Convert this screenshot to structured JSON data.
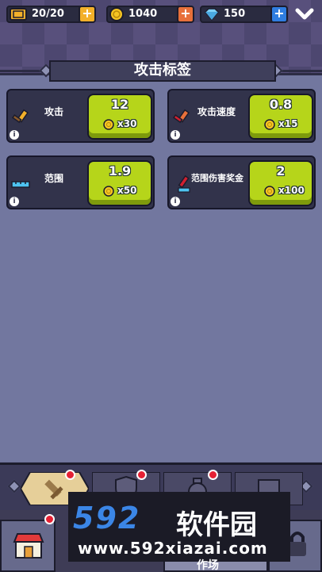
{
  "resources": {
    "energy": "20/20",
    "coins": "1040",
    "gems": "150"
  },
  "title": "攻击标签",
  "upgrades": [
    {
      "label": "攻击",
      "level": "12",
      "cost": "x30",
      "icon": "sword-icon"
    },
    {
      "label": "攻击速度",
      "level": "0.8",
      "cost": "x15",
      "icon": "fast-sword-icon"
    },
    {
      "label": "范围",
      "level": "1.9",
      "cost": "x50",
      "icon": "ruler-icon"
    },
    {
      "label": "范围伤害奖金",
      "level": "2",
      "cost": "x100",
      "icon": "sword-ruler-icon"
    }
  ],
  "tabs": [
    {
      "name": "attack",
      "icon": "sword-icon",
      "active": true
    },
    {
      "name": "defense",
      "icon": "shield-icon",
      "active": false
    },
    {
      "name": "economy",
      "icon": "money-bag-icon",
      "active": false
    },
    {
      "name": "utility",
      "icon": "box-icon",
      "active": false
    }
  ],
  "watermark": {
    "logo": "592",
    "chinese": "软件园",
    "url": "www.592xiazai.com"
  },
  "bottom_nav_label": "作场",
  "colors": {
    "button_green": "#b6d51a",
    "card_bg": "#32334b",
    "panel_bg": "#72779f",
    "notification_red": "#e52134"
  }
}
